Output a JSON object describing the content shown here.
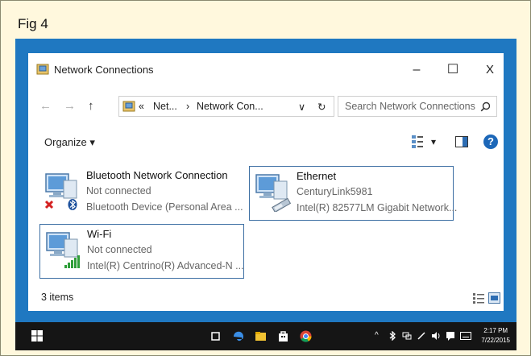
{
  "figure": {
    "label": "Fig 4"
  },
  "window": {
    "title": "Network Connections",
    "controls": {
      "minimize": "–",
      "maximize": "☐",
      "close": "X"
    }
  },
  "address": {
    "back": "←",
    "forward": "→",
    "up": "↑",
    "chevrons": "«",
    "crumbs": [
      "Net...",
      "Network Con..."
    ],
    "separator": "›",
    "dropdown": "∨",
    "refresh": "↻"
  },
  "search": {
    "placeholder": "Search Network Connections",
    "icon": "search-icon"
  },
  "toolbar": {
    "organize_label": "Organize ▾",
    "view_arrow": "▾",
    "help": "?"
  },
  "items": [
    {
      "name": "Bluetooth Network Connection",
      "status": "Not connected",
      "device": "Bluetooth Device (Personal Area ...",
      "selected": false,
      "badge": "red-x"
    },
    {
      "name": "Ethernet",
      "status": "CenturyLink5981",
      "device": "Intel(R) 82577LM Gigabit Network...",
      "selected": true,
      "badge": "cable"
    },
    {
      "name": "Wi-Fi",
      "status": "Not connected",
      "device": "Intel(R) Centrino(R) Advanced-N ...",
      "selected": true,
      "badge": "signal-bars"
    }
  ],
  "status": {
    "count": "3 items"
  },
  "taskbar": {
    "time": "2:17 PM",
    "date": "7/22/2015"
  },
  "colors": {
    "desktop": "#1f78c1",
    "frame": "#fff8dd",
    "selection_border": "#3d6fa3",
    "help": "#1c67b8"
  }
}
